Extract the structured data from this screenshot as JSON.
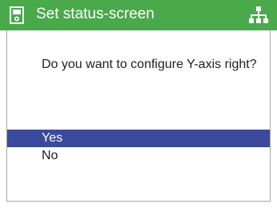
{
  "header": {
    "title": "Set status-screen",
    "left_icon": "device-icon",
    "right_icon": "network-icon",
    "background_color": "#4aa94a"
  },
  "dialog": {
    "question": "Do you want to configure Y-axis right?",
    "options": [
      {
        "label": "Yes",
        "selected": true
      },
      {
        "label": "No",
        "selected": false
      }
    ],
    "selection_color": "#3a4a9c"
  }
}
